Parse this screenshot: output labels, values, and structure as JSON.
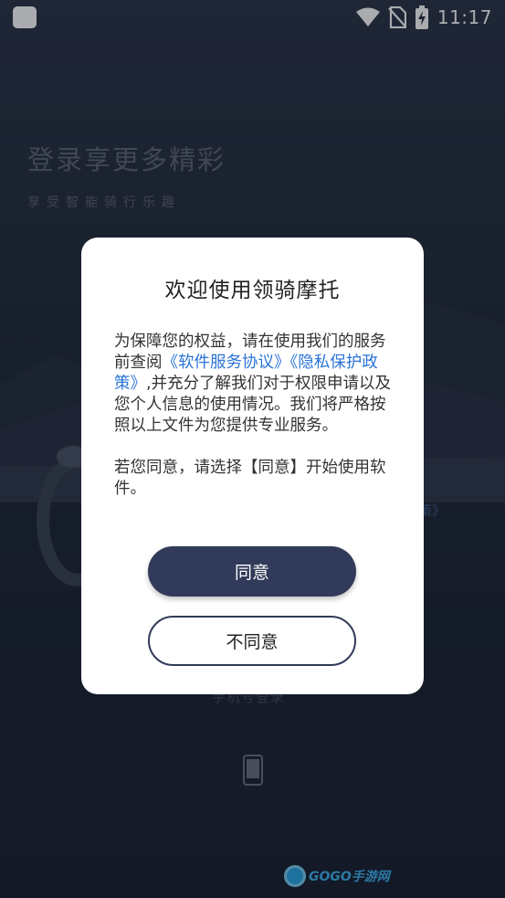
{
  "status_bar": {
    "time": "11:17",
    "icons": [
      "app-notification-icon",
      "wifi-icon",
      "no-sim-icon",
      "battery-charging-icon"
    ]
  },
  "background": {
    "title": "登录享更多精彩",
    "subtitle": "享受智能骑行乐趣",
    "link_fragment": "策》",
    "phone_login": "手机号登录"
  },
  "dialog": {
    "title": "欢迎使用领骑摩托",
    "body_prefix": "为保障您的权益，请在使用我们的服务前查阅",
    "link_service": "《软件服务协议》",
    "link_privacy": "《隐私保护政策》",
    "body_suffix": ",并充分了解我们对于权限申请以及您个人信息的使用情况。我们将严格按照以上文件为您提供专业服务。",
    "body_consent": "若您同意，请选择【同意】开始使用软件。",
    "agree_label": "同意",
    "disagree_label": "不同意"
  },
  "watermark": {
    "text": "GOGO手游网"
  },
  "colors": {
    "accent_button": "#323a5a",
    "link": "#2a74d6",
    "background": "#222a3a"
  }
}
